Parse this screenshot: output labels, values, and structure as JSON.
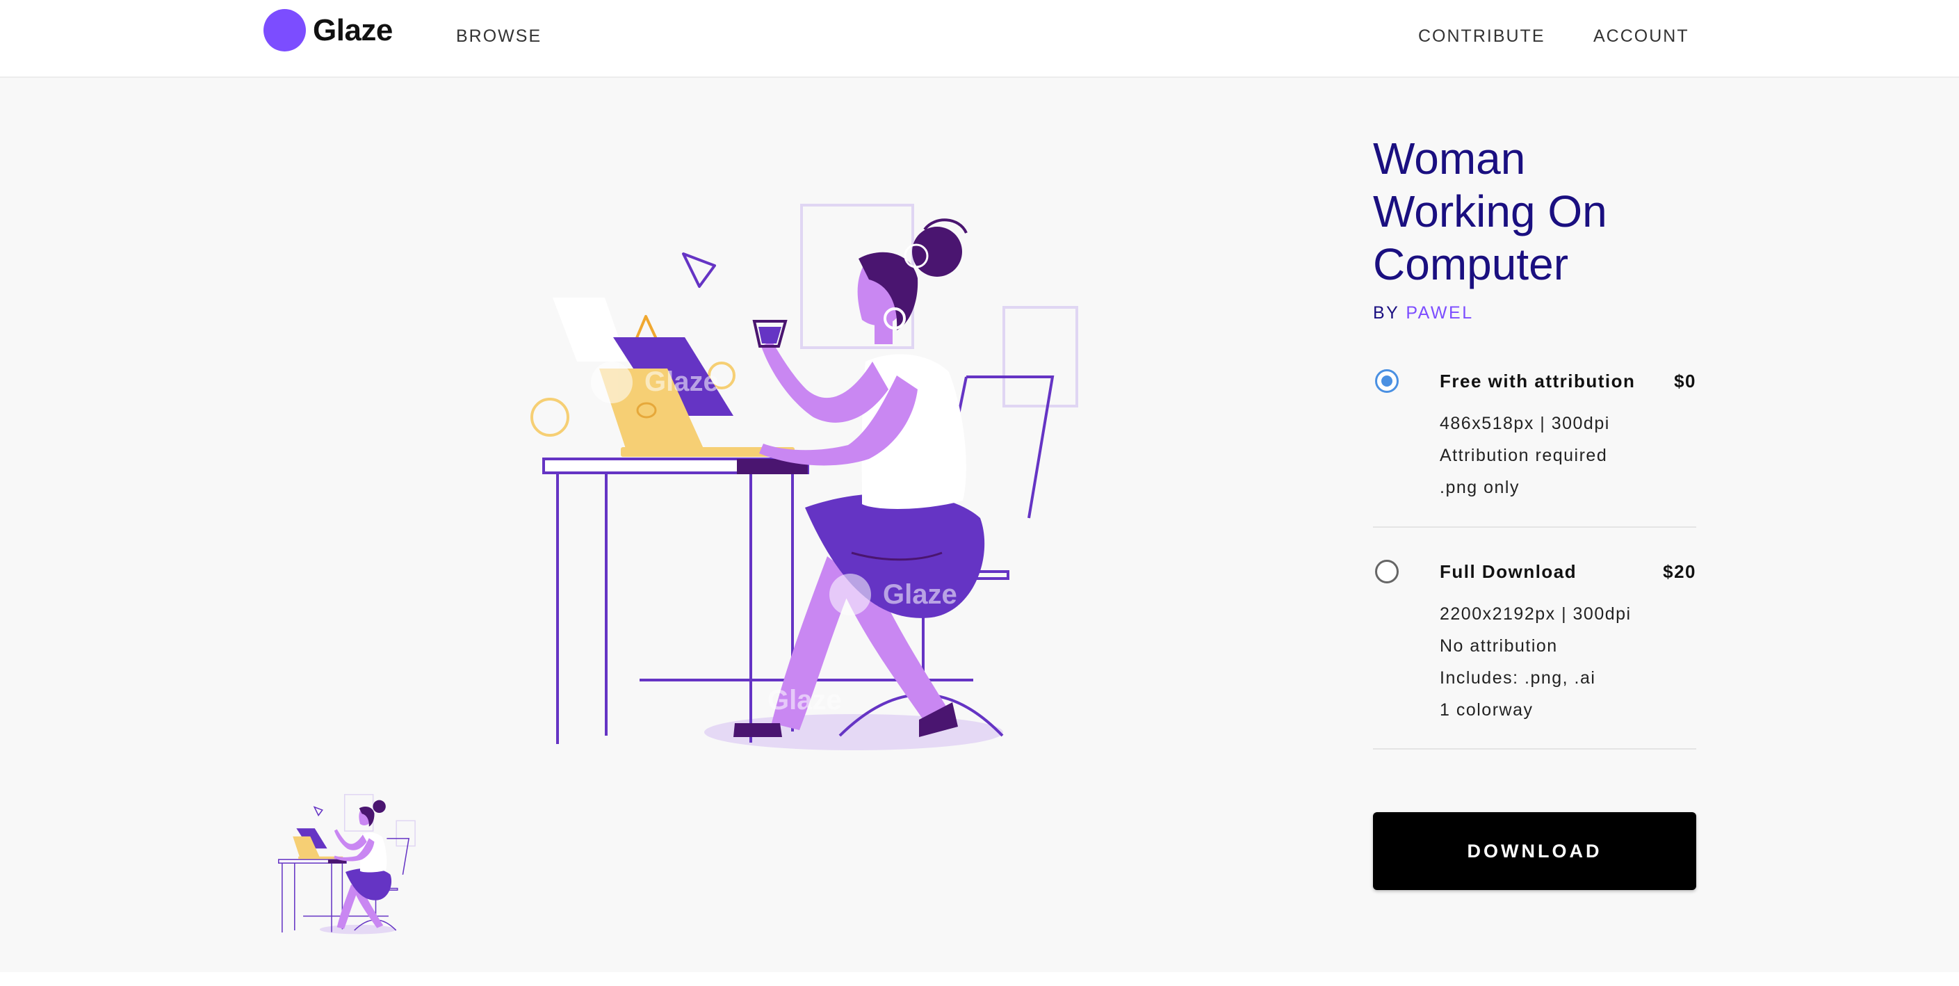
{
  "header": {
    "logo_text": "Glaze",
    "nav_left": [
      {
        "label": "BROWSE"
      }
    ],
    "nav_right": [
      {
        "label": "CONTRIBUTE"
      },
      {
        "label": "ACCOUNT"
      }
    ]
  },
  "product": {
    "title_lines": [
      "Woman",
      "Working On",
      "Computer"
    ],
    "by_label": "BY",
    "author": "PAWEL"
  },
  "options": [
    {
      "name": "Free with attribution",
      "price": "$0",
      "selected": true,
      "details": [
        "486x518px | 300dpi",
        "Attribution required",
        ".png only"
      ]
    },
    {
      "name": "Full Download",
      "price": "$20",
      "selected": false,
      "details": [
        "2200x2192px | 300dpi",
        "No attribution",
        "Includes: .png, .ai",
        "1 colorway"
      ]
    }
  ],
  "download": {
    "label": "DOWNLOAD"
  },
  "illustration": {
    "watermark_text": "Glaze",
    "colors": {
      "purple_dark": "#4a1570",
      "purple": "#6534c4",
      "purple_light": "#c987f2",
      "purple_pale": "#e5d9f5",
      "yellow": "#f6cf74",
      "outline": "#5b2fbf",
      "brand": "#7c4dff",
      "title": "#1a0f80"
    }
  }
}
